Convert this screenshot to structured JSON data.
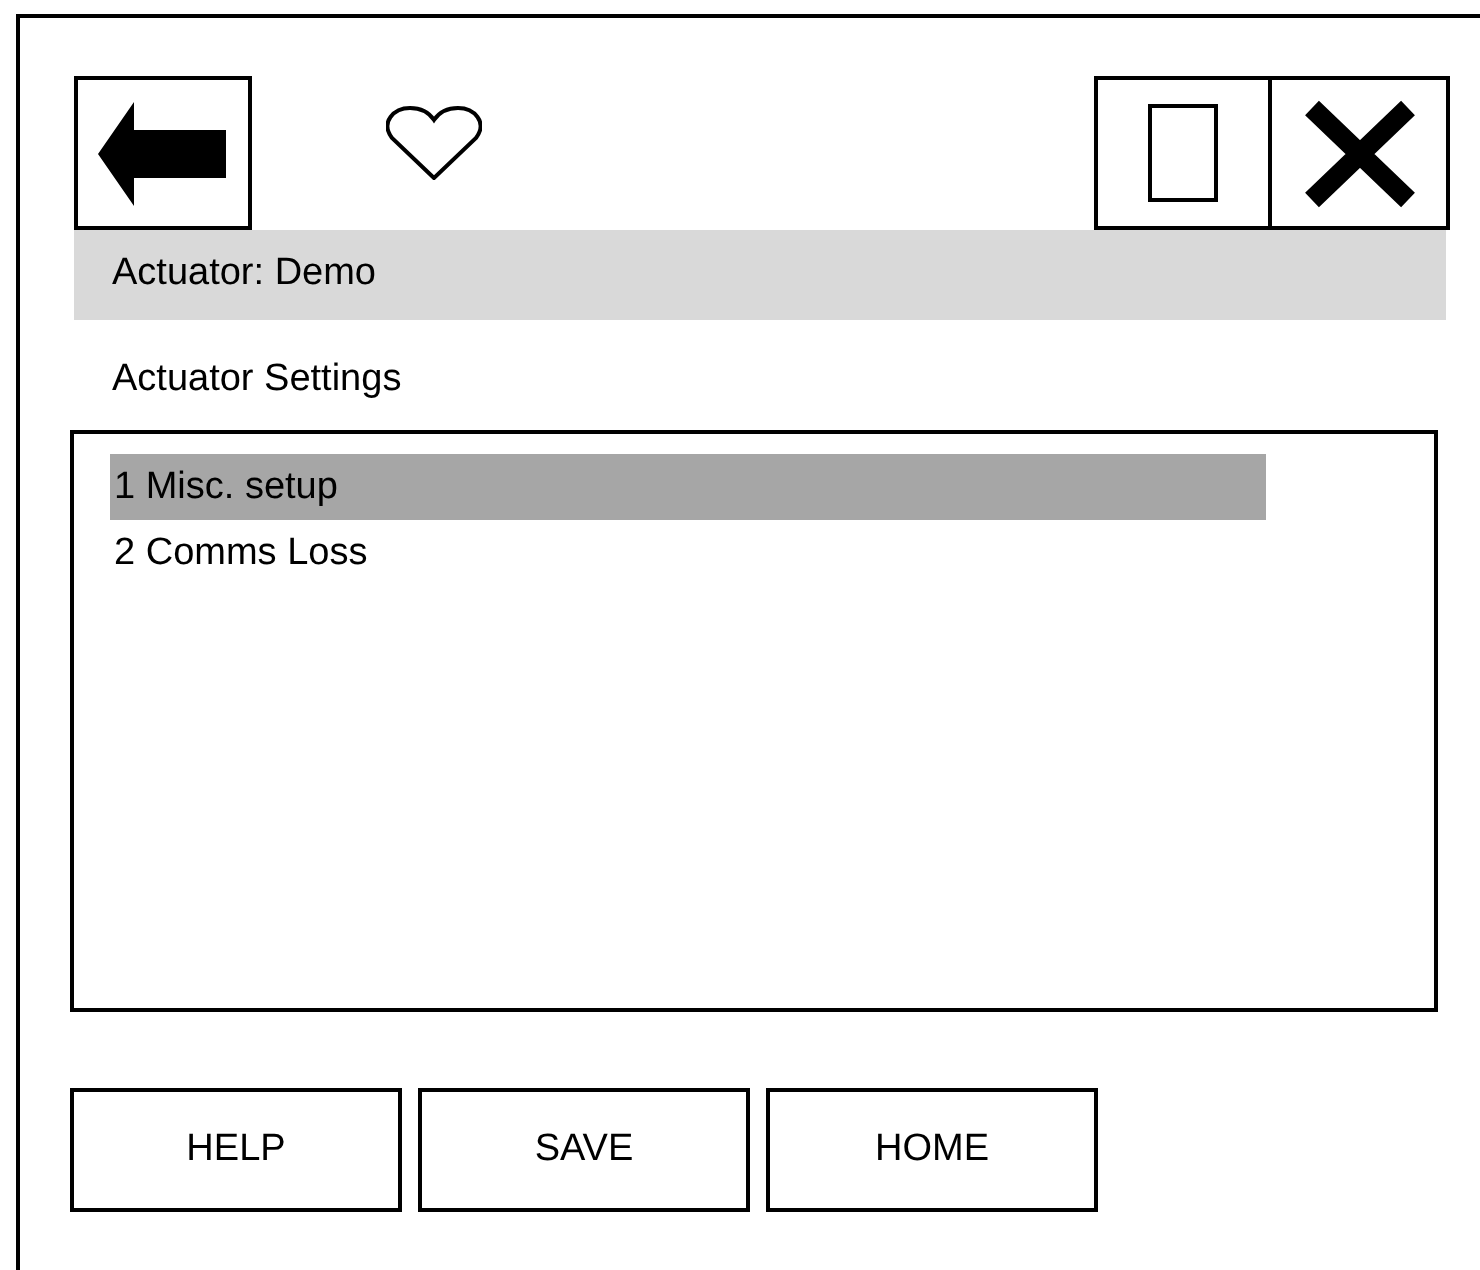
{
  "header": {
    "title": "Actuator: Demo"
  },
  "section": {
    "title": "Actuator Settings"
  },
  "menu": {
    "items": [
      {
        "label": "1 Misc. setup",
        "selected": true
      },
      {
        "label": "2 Comms Loss",
        "selected": false
      }
    ]
  },
  "buttons": [
    "HELP",
    "SAVE",
    "HOME"
  ]
}
